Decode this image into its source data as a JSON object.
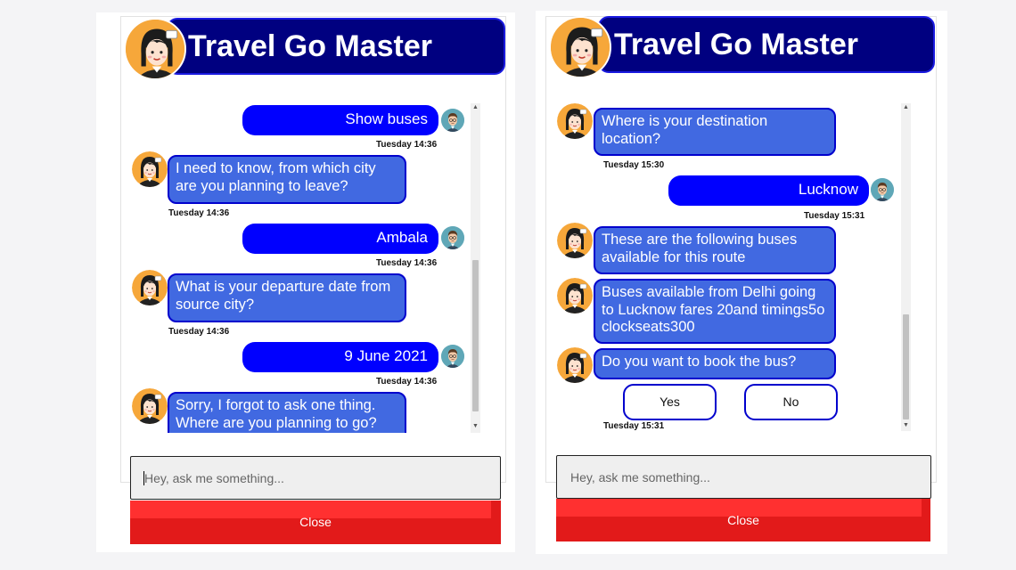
{
  "left_panel": {
    "title": "Travel Go Master",
    "messages": [
      {
        "from": "user",
        "text": "Show buses",
        "time": "Tuesday 14:36"
      },
      {
        "from": "bot",
        "text": "I need to know, from which city are you planning to leave?",
        "time": "Tuesday 14:36"
      },
      {
        "from": "user",
        "text": "Ambala",
        "time": "Tuesday 14:36"
      },
      {
        "from": "bot",
        "text": "What is your departure date from source city?",
        "time": "Tuesday 14:36"
      },
      {
        "from": "user",
        "text": "9 June 2021",
        "time": "Tuesday 14:36"
      },
      {
        "from": "bot",
        "text": "Sorry, I forgot to ask one thing. Where are you planning to go?"
      }
    ],
    "input_placeholder": "Hey, ask me something...",
    "close_label": "Close"
  },
  "right_panel": {
    "title": "Travel Go Master",
    "messages": [
      {
        "from": "bot",
        "text": "Where is your destination location?",
        "time": "Tuesday 15:30"
      },
      {
        "from": "user",
        "text": "Lucknow",
        "time": "Tuesday 15:31"
      },
      {
        "from": "bot",
        "text": "These are the following buses available for this route"
      },
      {
        "from": "bot",
        "text": "Buses available from Delhi going to Lucknow fares 20and timings5o clockseats300"
      },
      {
        "from": "bot",
        "text": "Do you want to book the bus?",
        "time": "Tuesday 15:31"
      }
    ],
    "choices": [
      "Yes",
      "No"
    ],
    "input_placeholder": "Hey, ask me something...",
    "close_label": "Close"
  },
  "colors": {
    "header_bg": "#000080",
    "user_bubble": "#0000ff",
    "bot_bubble": "#4169e1",
    "close_button": "#e21a1a"
  },
  "icons": {
    "bot_avatar": "assistant-woman-avatar-icon",
    "user_avatar": "user-man-avatar-icon",
    "scroll_up": "scroll-up-arrow-icon",
    "scroll_down": "scroll-down-arrow-icon"
  }
}
